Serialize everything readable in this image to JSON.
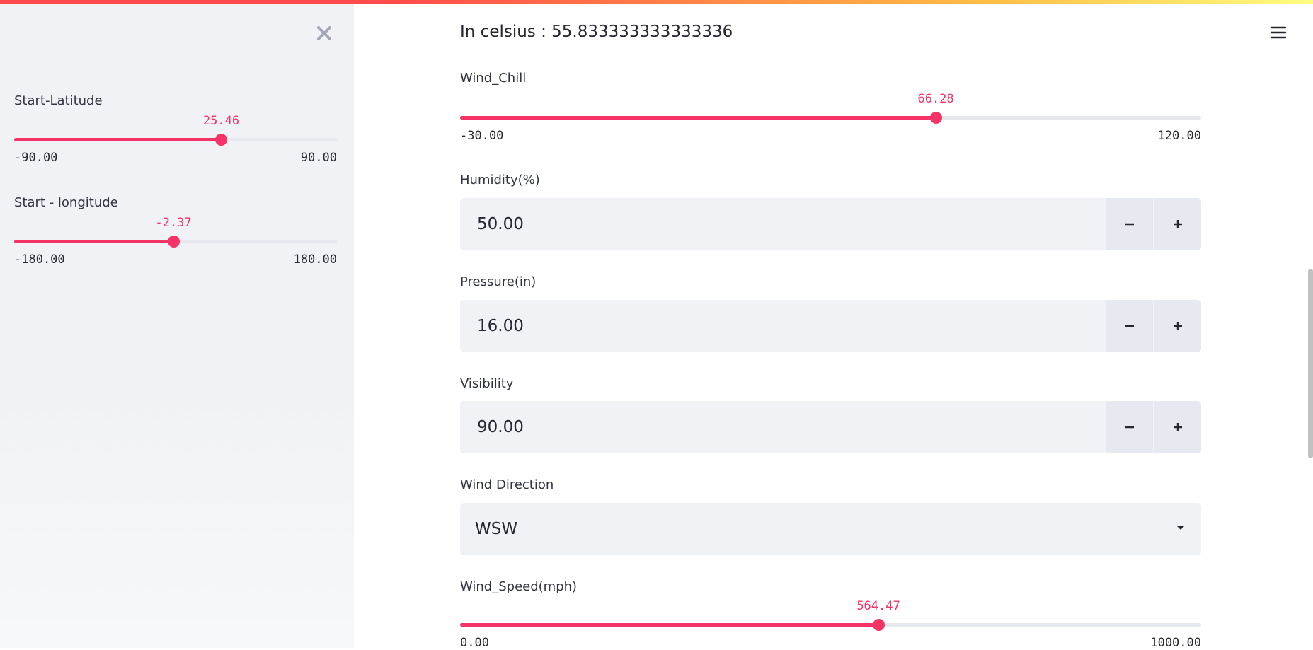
{
  "sidebar": {
    "close_icon": "close-icon",
    "sliders": [
      {
        "label": "Start-Latitude",
        "value": "25.46",
        "min": "-90.00",
        "max": "90.00",
        "fraction": 0.6414
      },
      {
        "label": "Start - longitude",
        "value": "-2.37",
        "min": "-180.00",
        "max": "180.00",
        "fraction": 0.4934
      }
    ]
  },
  "main": {
    "celsius_text": "In celsius : 55.833333333333336",
    "menu_icon": "hamburger-menu-icon",
    "wind_chill": {
      "label": "Wind_Chill",
      "value": "66.28",
      "min": "-30.00",
      "max": "120.00",
      "fraction": 0.6419
    },
    "humidity": {
      "label": "Humidity(%)",
      "value": "50.00"
    },
    "pressure": {
      "label": "Pressure(in)",
      "value": "16.00"
    },
    "visibility": {
      "label": "Visibility",
      "value": "90.00"
    },
    "wind_direction": {
      "label": "Wind Direction",
      "selected": "WSW"
    },
    "wind_speed": {
      "label": "Wind_Speed(mph)",
      "value": "564.47",
      "min": "0.00",
      "max": "1000.00",
      "fraction": 0.5645
    },
    "stepper_minus": "−",
    "stepper_plus": "+"
  },
  "colors": {
    "accent": "#f63366",
    "sidebar_bg": "#f0f2f6",
    "input_bg": "#f0f2f6"
  }
}
